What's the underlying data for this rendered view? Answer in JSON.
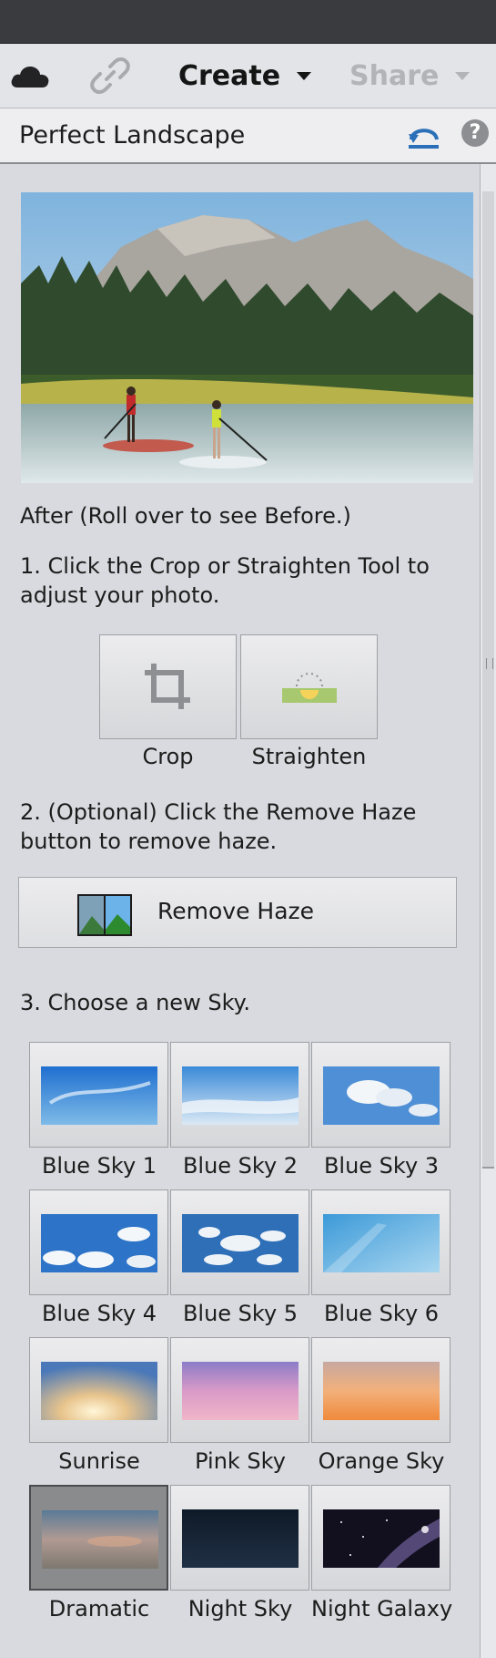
{
  "toolbar": {
    "create_label": "Create",
    "share_label": "Share",
    "icons": [
      "cloud-icon",
      "link-icon",
      "chevron-down-icon"
    ]
  },
  "panel": {
    "title": "Perfect Landscape",
    "icons": [
      "undo-icon",
      "help-icon"
    ],
    "help_glyph": "?"
  },
  "content": {
    "preview_caption": "After (Roll over to see Before.)",
    "step1": "1. Click the Crop or Straighten Tool to adjust your photo.",
    "crop_label": "Crop",
    "straighten_label": "Straighten",
    "step2": "2. (Optional) Click the Remove Haze button to remove haze.",
    "remove_haze_label": "Remove Haze",
    "step3": "3. Choose a new Sky."
  },
  "skies": [
    {
      "label": "Blue Sky 1",
      "selected": false
    },
    {
      "label": "Blue Sky 2",
      "selected": false
    },
    {
      "label": "Blue Sky 3",
      "selected": false
    },
    {
      "label": "Blue Sky 4",
      "selected": false
    },
    {
      "label": "Blue Sky 5",
      "selected": false
    },
    {
      "label": "Blue Sky 6",
      "selected": false
    },
    {
      "label": "Sunrise",
      "selected": false
    },
    {
      "label": "Pink Sky",
      "selected": false
    },
    {
      "label": "Orange Sky",
      "selected": false
    },
    {
      "label": "Dramatic",
      "selected": true
    },
    {
      "label": "Night Sky",
      "selected": false
    },
    {
      "label": "Night Galaxy",
      "selected": false
    }
  ],
  "colors": {
    "accent_blue": "#2a6fb7",
    "panel_bg": "#d9dadf"
  }
}
